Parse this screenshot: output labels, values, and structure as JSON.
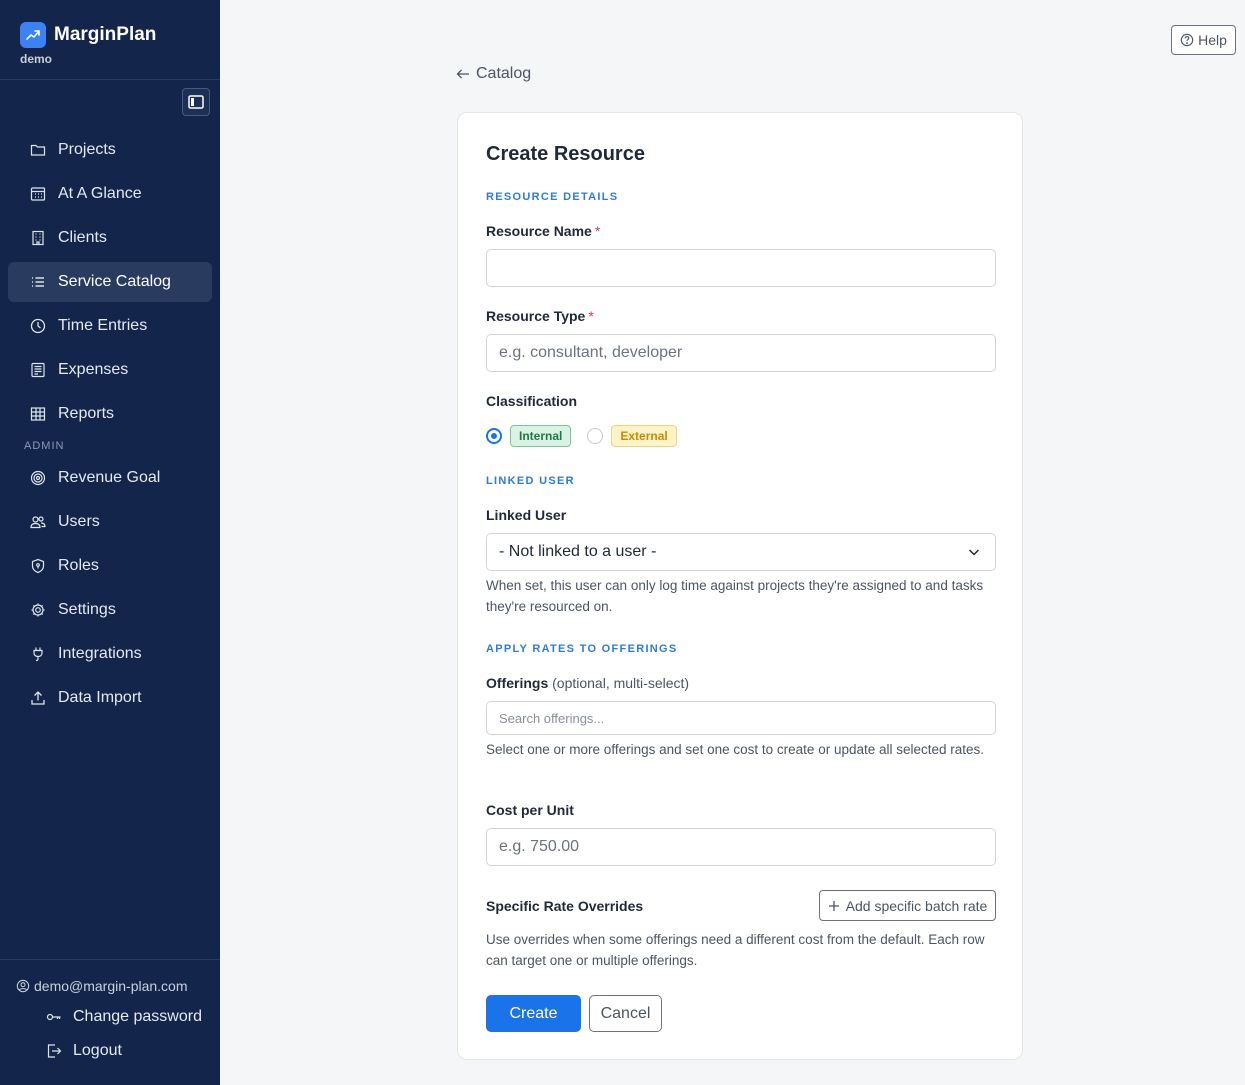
{
  "app": {
    "name": "MarginPlan",
    "workspace": "demo"
  },
  "sidebar": {
    "items": [
      {
        "label": "Projects",
        "icon": "folder-icon"
      },
      {
        "label": "At A Glance",
        "icon": "calendar-grid-icon"
      },
      {
        "label": "Clients",
        "icon": "building-icon"
      },
      {
        "label": "Service Catalog",
        "icon": "list-icon",
        "active": true
      },
      {
        "label": "Time Entries",
        "icon": "clock-icon"
      },
      {
        "label": "Expenses",
        "icon": "receipt-icon"
      },
      {
        "label": "Reports",
        "icon": "table-icon"
      }
    ],
    "admin_label": "ADMIN",
    "admin_items": [
      {
        "label": "Revenue Goal",
        "icon": "target-icon"
      },
      {
        "label": "Users",
        "icon": "users-icon"
      },
      {
        "label": "Roles",
        "icon": "shield-icon"
      },
      {
        "label": "Settings",
        "icon": "gear-icon"
      },
      {
        "label": "Integrations",
        "icon": "plug-icon"
      },
      {
        "label": "Data Import",
        "icon": "upload-icon"
      }
    ],
    "account": {
      "email": "demo@margin-plan.com",
      "change_password": "Change password",
      "logout": "Logout"
    }
  },
  "header": {
    "help_label": "Help",
    "back_label": "Catalog"
  },
  "form": {
    "title": "Create Resource",
    "sections": {
      "details": "RESOURCE DETAILS",
      "linked": "LINKED USER",
      "rates": "APPLY RATES TO OFFERINGS"
    },
    "resource_name": {
      "label": "Resource Name",
      "required": "*",
      "value": ""
    },
    "resource_type": {
      "label": "Resource Type",
      "required": "*",
      "placeholder": "e.g. consultant, developer"
    },
    "classification": {
      "label": "Classification",
      "options": [
        "Internal",
        "External"
      ],
      "selected": "Internal"
    },
    "linked_user": {
      "label": "Linked User",
      "value": "- Not linked to a user -",
      "help": "When set, this user can only log time against projects they're assigned to and tasks they're resourced on."
    },
    "offerings": {
      "label": "Offerings",
      "hint": "(optional, multi-select)",
      "placeholder": "Search offerings...",
      "help": "Select one or more offerings and set one cost to create or update all selected rates."
    },
    "cost_per_unit": {
      "label": "Cost per Unit",
      "placeholder": "e.g. 750.00"
    },
    "overrides": {
      "label": "Specific Rate Overrides",
      "add_label": "Add specific batch rate",
      "help": "Use overrides when some offerings need a different cost from the default. Each row can target one or multiple offerings."
    },
    "buttons": {
      "create": "Create",
      "cancel": "Cancel"
    }
  },
  "colors": {
    "sidebar_bg": "#13254a",
    "accent": "#1a73e8",
    "section_label": "#2f7bd6"
  }
}
